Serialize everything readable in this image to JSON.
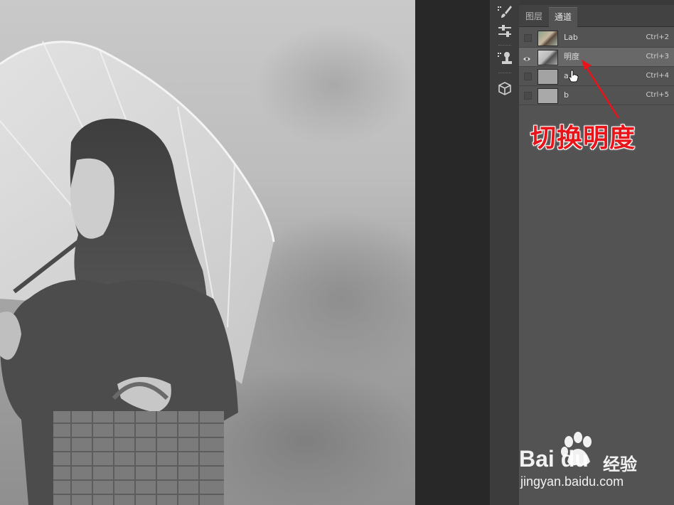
{
  "panel": {
    "tabs": [
      {
        "label": "图层",
        "active": false
      },
      {
        "label": "通道",
        "active": true
      }
    ],
    "channels": [
      {
        "name": "Lab",
        "shortcut": "Ctrl+2",
        "visible": false,
        "selected": false,
        "thumb": "color"
      },
      {
        "name": "明度",
        "shortcut": "Ctrl+3",
        "visible": true,
        "selected": true,
        "thumb": "gray"
      },
      {
        "name": "a",
        "shortcut": "Ctrl+4",
        "visible": false,
        "selected": false,
        "thumb": "flat"
      },
      {
        "name": "b",
        "shortcut": "Ctrl+5",
        "visible": false,
        "selected": false,
        "thumb": "flat"
      }
    ]
  },
  "toolstrip": {
    "icons": [
      "brush-presets-icon",
      "adjustments-icon",
      "clone-source-icon",
      "3d-icon"
    ]
  },
  "annotation": {
    "text": "切换明度",
    "color": "#e8141a"
  },
  "watermark": {
    "logo": "Bai du",
    "brand": "经验",
    "url": "jingyan.baidu.com"
  },
  "colors": {
    "panel_bg": "#535353",
    "selected_row": "#686868",
    "toolstrip_bg": "#3c3c3c"
  }
}
